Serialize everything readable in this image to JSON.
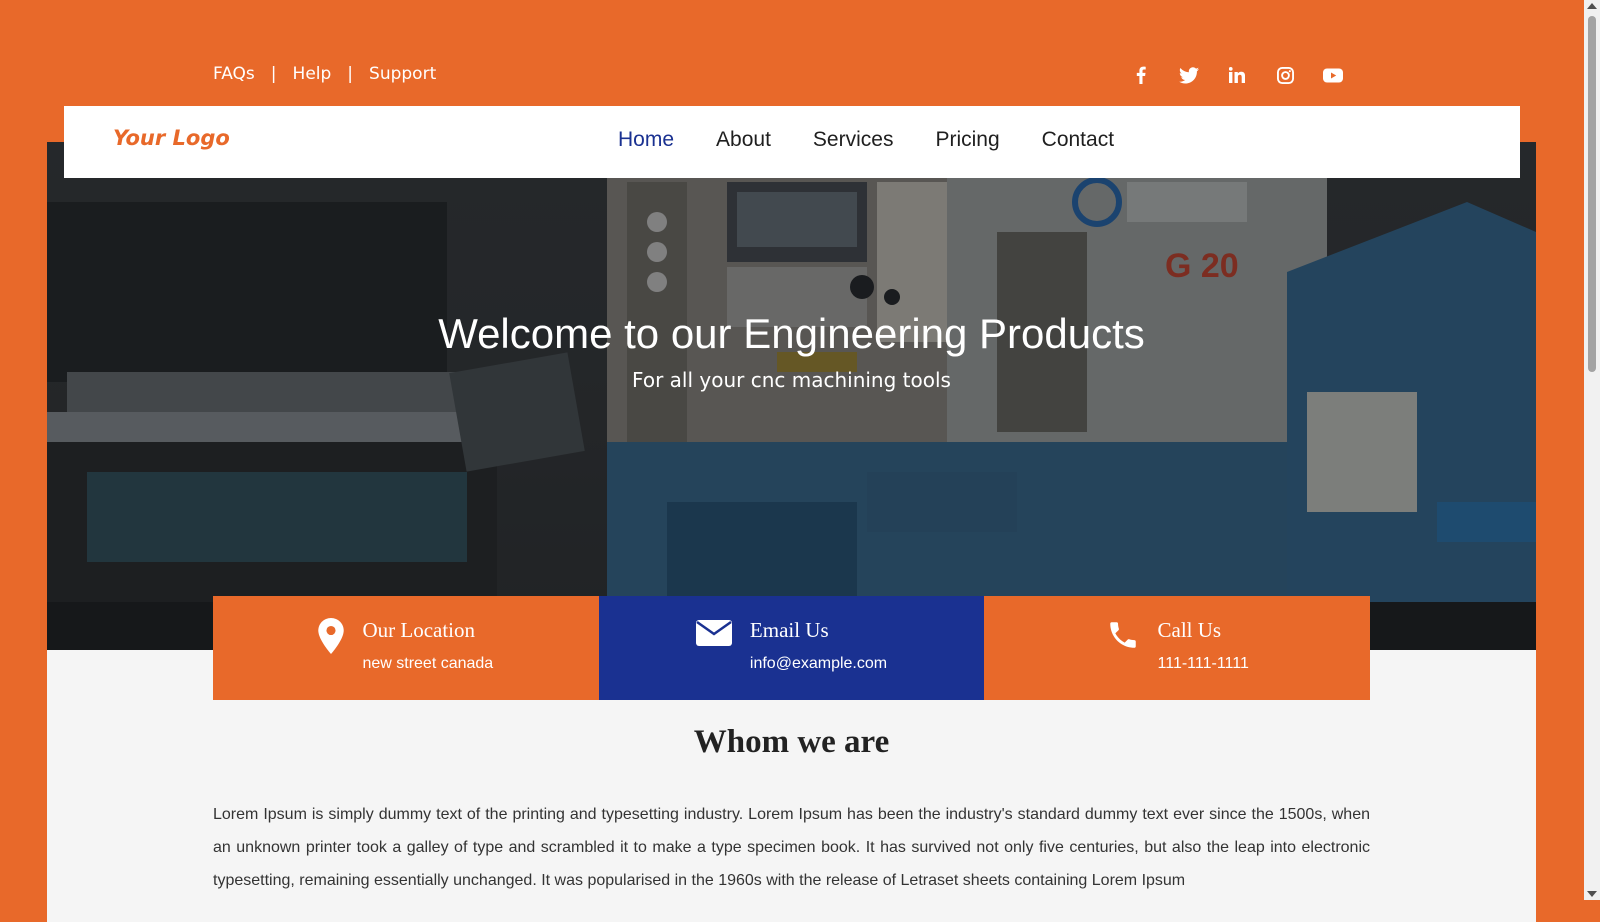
{
  "colors": {
    "accent": "#e8692a",
    "brand_blue": "#1a3191",
    "panel": "#f5f5f5"
  },
  "topbar": {
    "links": [
      "FAQs",
      "Help",
      "Support"
    ],
    "separator": "|"
  },
  "social": {
    "icons": [
      "facebook-icon",
      "twitter-icon",
      "linkedin-icon",
      "instagram-icon",
      "youtube-icon"
    ]
  },
  "navbar": {
    "logo": "Your Logo",
    "menu": [
      "Home",
      "About",
      "Services",
      "Pricing",
      "Contact"
    ],
    "active": "Home"
  },
  "hero": {
    "title": "Welcome to our Engineering Products",
    "subtitle": "For all your cnc machining tools",
    "machine_label": "G 20"
  },
  "info": [
    {
      "icon": "location-pin-icon",
      "title": "Our Location",
      "text": "new street canada"
    },
    {
      "icon": "envelope-icon",
      "title": "Email Us",
      "text": "info@example.com"
    },
    {
      "icon": "phone-icon",
      "title": "Call Us",
      "text": "111-111-1111"
    }
  ],
  "about": {
    "title": "Whom we are",
    "text": "Lorem Ipsum is simply dummy text of the printing and typesetting industry. Lorem Ipsum has been the industry's standard dummy text ever since the 1500s, when an unknown printer took a galley of type and scrambled it to make a type specimen book. It has survived not only five centuries, but also the leap into electronic typesetting, remaining essentially unchanged. It was popularised in the 1960s with the release of Letraset sheets containing Lorem Ipsum"
  }
}
